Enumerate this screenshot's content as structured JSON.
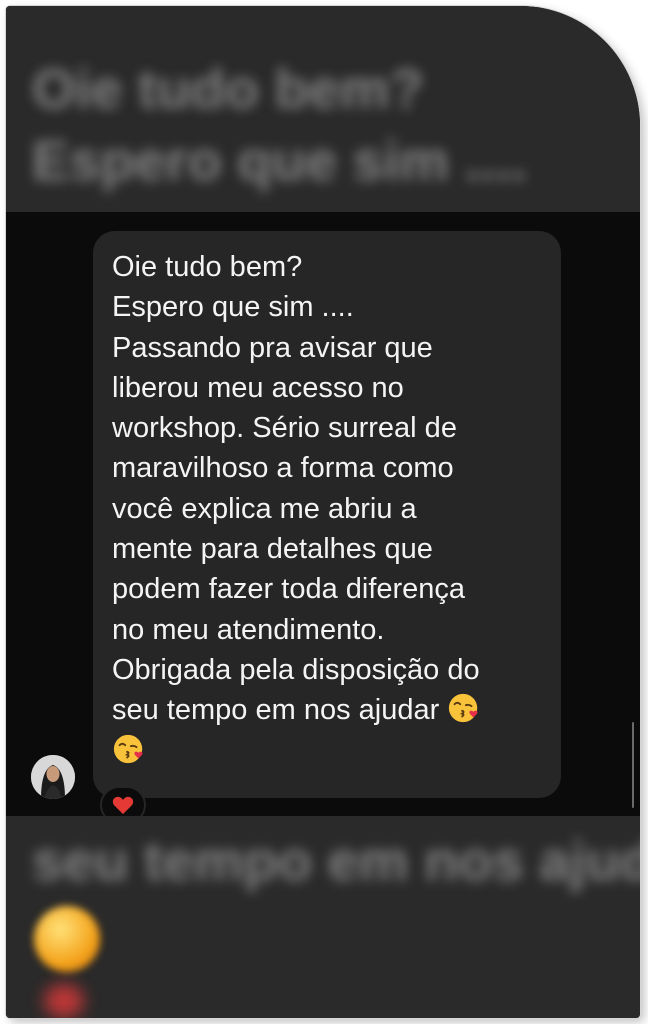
{
  "conversation": {
    "preview_top": {
      "line1": "Oie tudo bem?",
      "line2": "Espero que sim ...."
    },
    "message": {
      "lines": [
        "Oie tudo bem?",
        "Espero que sim ....",
        "Passando pra avisar que",
        "liberou meu acesso no",
        "workshop. Sério surreal de",
        "maravilhoso a forma como",
        "você explica me abriu a",
        "mente para detalhes que",
        "podem fazer toda diferença",
        "no meu atendimento.",
        "Obrigada pela disposição do",
        "seu tempo em nos ajudar"
      ],
      "emojis": [
        "kissing-face-emoji",
        "kissing-face-emoji"
      ],
      "reaction": "heart-reaction-icon"
    },
    "preview_bottom": {
      "line1": "seu tempo em nos ajuda"
    }
  },
  "colors": {
    "background": "#0b0b0b",
    "bubble": "#262626",
    "text": "#f4f4f4",
    "reaction_heart": "#e53935"
  }
}
